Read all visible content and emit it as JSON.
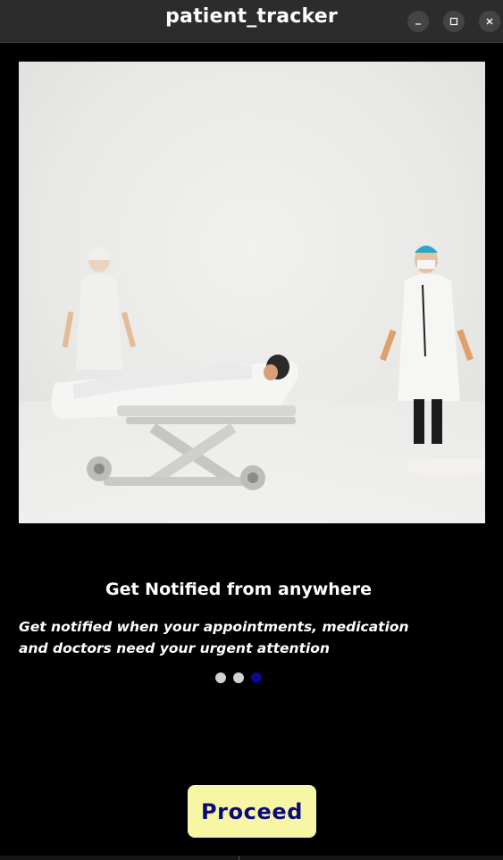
{
  "window": {
    "title": "patient_tracker",
    "controls": {
      "minimize_icon": "minimize-icon",
      "maximize_icon": "maximize-icon",
      "close_icon": "close-icon"
    }
  },
  "onboarding": {
    "image_icon": "hospital-figurines-photo",
    "heading": "Get Notified from anywhere",
    "description": "Get notified when your appointments, medication and doctors need your urgent attention",
    "pagination": {
      "total": 3,
      "active_index": 2
    },
    "proceed_label": "Proceed"
  },
  "colors": {
    "background": "#000000",
    "titlebar": "#2c2c2c",
    "dot_inactive": "#d2d2d2",
    "dot_active": "#0a0a8c",
    "button_bg": "#f6f6a4",
    "button_text": "#0a0a7a"
  }
}
